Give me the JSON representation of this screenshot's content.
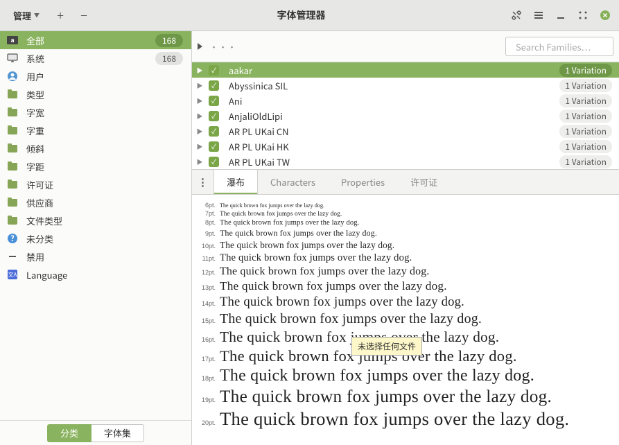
{
  "titlebar": {
    "manage": "管理",
    "title": "字体管理器"
  },
  "sidebar": {
    "items": [
      {
        "label": "全部",
        "count": "168",
        "icon": "all",
        "selected": true
      },
      {
        "label": "系统",
        "count": "168",
        "icon": "monitor"
      },
      {
        "label": "用户",
        "icon": "user"
      },
      {
        "label": "类型",
        "icon": "folder"
      },
      {
        "label": "字宽",
        "icon": "folder"
      },
      {
        "label": "字重",
        "icon": "folder"
      },
      {
        "label": "倾斜",
        "icon": "folder"
      },
      {
        "label": "字距",
        "icon": "folder"
      },
      {
        "label": "许可证",
        "icon": "folder"
      },
      {
        "label": "供应商",
        "icon": "folder"
      },
      {
        "label": "文件类型",
        "icon": "folder"
      },
      {
        "label": "未分类",
        "icon": "help"
      },
      {
        "label": "禁用",
        "icon": "minus"
      },
      {
        "label": "Language",
        "icon": "lang"
      }
    ],
    "tabs": {
      "a": "分类",
      "b": "字体集"
    }
  },
  "search": {
    "placeholder": "Search Families…"
  },
  "fonts": [
    {
      "name": "aakar",
      "var": "1 Variation",
      "selected": true
    },
    {
      "name": "Abyssinica SIL",
      "var": "1 Variation"
    },
    {
      "name": "Ani",
      "var": "1 Variation"
    },
    {
      "name": "AnjaliOldLipi",
      "var": "1 Variation"
    },
    {
      "name": "AR PL UKai CN",
      "var": "1 Variation"
    },
    {
      "name": "AR PL UKai HK",
      "var": "1 Variation"
    },
    {
      "name": "AR PL UKai TW",
      "var": "1 Variation"
    }
  ],
  "preview_tabs": {
    "a": "瀑布",
    "b": "Characters",
    "c": "Properties",
    "d": "许可证"
  },
  "preview": {
    "text": "The quick brown fox jumps over the lazy dog.",
    "sizes": [
      "6pt.",
      "7pt.",
      "8pt.",
      "9pt.",
      "10pt.",
      "11pt.",
      "12pt.",
      "13pt.",
      "14pt.",
      "15pt.",
      "16pt.",
      "17pt.",
      "18pt.",
      "19pt.",
      "20pt."
    ]
  },
  "tooltip": "未选择任何文件"
}
